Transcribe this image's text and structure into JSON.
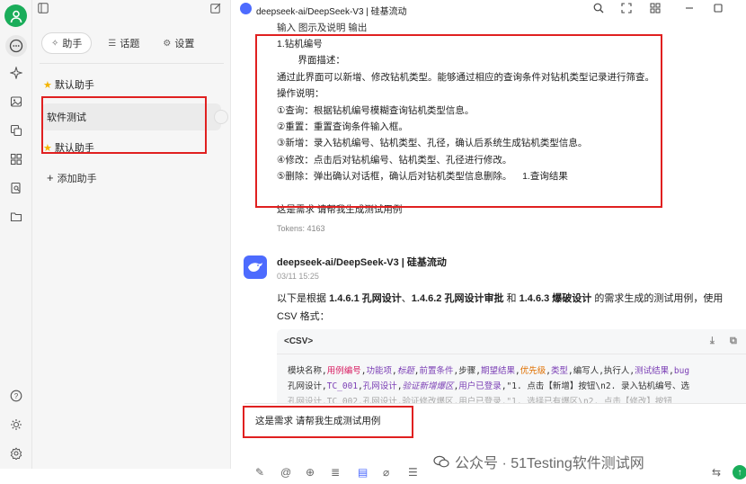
{
  "rail": {
    "icons": [
      "user-avatar",
      "chat-icon",
      "sparkle-icon",
      "image-icon",
      "translate-icon",
      "apps-icon",
      "document-search-icon",
      "folder-icon",
      "help-icon",
      "theme-icon",
      "settings-icon"
    ]
  },
  "sidebar": {
    "tabs": [
      {
        "label": "助手",
        "icon": "sparkle-icon"
      },
      {
        "label": "话题",
        "icon": "list-icon"
      },
      {
        "label": "设置",
        "icon": "gear-icon"
      }
    ],
    "items": [
      {
        "label": "默认助手",
        "starred": true
      },
      {
        "label": "软件测试",
        "starred": false,
        "selected": true
      },
      {
        "label": "默认助手",
        "starred": true
      }
    ],
    "add_label": "添加助手"
  },
  "topbar": {
    "model": "deepseek-ai/DeepSeek-V3 | 硅基流动"
  },
  "user_message": {
    "header": "输入      图示及说明  输出",
    "lines": [
      "1.钻机编号",
      "        界面描述：",
      "通过此界面可以新增、修改钻机类型。能够通过相应的查询条件对钻机类型记录进行筛查。",
      "操作说明：",
      "①查询：根据钻机编号模糊查询钻机类型信息。",
      "②重置：重置查询条件输入框。",
      "③新增：录入钻机编号、钻机类型、孔径，确认后系统生成钻机类型信息。",
      "④修改：点击后对钻机编号、钻机类型、孔径进行修改。",
      "⑤删除：弹出确认对话框，确认后对钻机类型信息删除。    1.查询结果",
      "",
      "这是需求 请帮我生成测试用例"
    ],
    "tokens": "Tokens: 4163"
  },
  "bot_message": {
    "name": "deepseek-ai/DeepSeek-V3 | 硅基流动",
    "time": "03/11 15:25",
    "text_pre": "以下是根据 ",
    "bold1": "1.4.6.1 孔网设计",
    "sep1": "、",
    "bold2": "1.4.6.2 孔网设计审批",
    "sep2": " 和 ",
    "bold3": "1.4.6.3 爆破设计",
    "text_post": " 的需求生成的测试用例，使用 CSV 格式：",
    "code_lang": "<CSV>",
    "code_line1": [
      "模块名称,",
      "用例编号",
      ",",
      "功能项",
      ",",
      "标题",
      ",",
      "前置条件",
      ",步骤,",
      "期望结果",
      ",",
      "优先级",
      ",",
      "类型",
      ",编写人,执行人,",
      "测试结果",
      ",",
      "bug"
    ],
    "code_line2": [
      "孔网设计,",
      "TC_001",
      ",",
      "孔网设计",
      ",",
      "验证新增爆区",
      ",",
      "用户已登录",
      ",\"1. 点击【新增】按钮\\n2. 录入钻机编号、选"
    ],
    "code_line3": "孔网设计,TC_002,孔网设计,验证修改爆区,用户已登录,\"1. 选择已有爆区\\n2. 点击【修改】按钮"
  },
  "input": {
    "value": "这是需求 请帮我生成测试用例"
  },
  "watermark": "公众号 · 51Testing软件测试网"
}
